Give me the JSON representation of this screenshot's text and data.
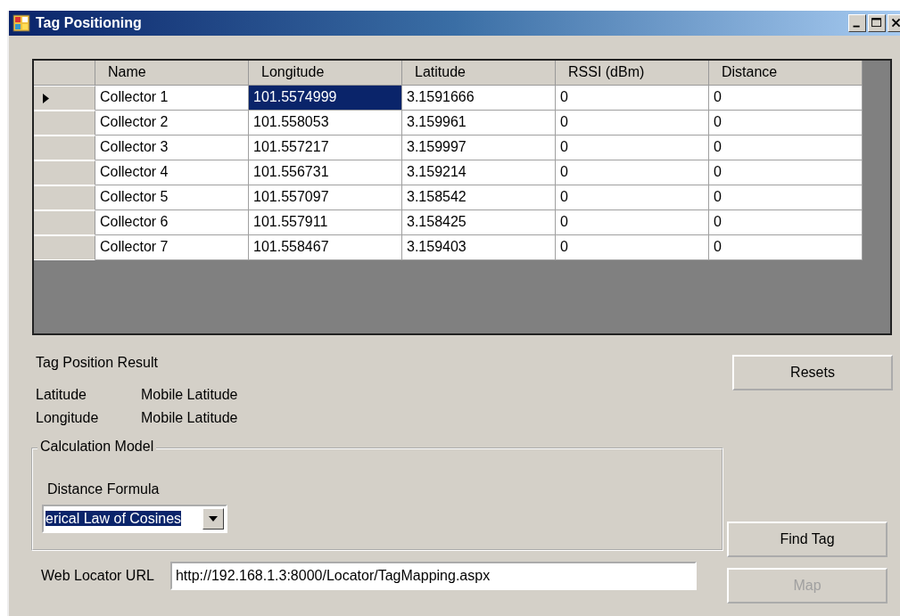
{
  "window": {
    "title": "Tag Positioning"
  },
  "table": {
    "columns": [
      "Name",
      "Longitude",
      "Latitude",
      "RSSI (dBm)",
      "Distance"
    ],
    "rows": [
      {
        "current": true,
        "cells": [
          {
            "text": "Collector 1",
            "selected": false
          },
          {
            "text": "101.5574999",
            "selected": true
          },
          {
            "text": "3.1591666",
            "selected": false
          },
          {
            "text": "0",
            "selected": false
          },
          {
            "text": "0",
            "selected": false
          }
        ]
      },
      {
        "current": false,
        "cells": [
          {
            "text": "Collector 2",
            "selected": false
          },
          {
            "text": "101.558053",
            "selected": false
          },
          {
            "text": "3.159961",
            "selected": false
          },
          {
            "text": "0",
            "selected": false
          },
          {
            "text": "0",
            "selected": false
          }
        ]
      },
      {
        "current": false,
        "cells": [
          {
            "text": "Collector 3",
            "selected": false
          },
          {
            "text": "101.557217",
            "selected": false
          },
          {
            "text": "3.159997",
            "selected": false
          },
          {
            "text": "0",
            "selected": false
          },
          {
            "text": "0",
            "selected": false
          }
        ]
      },
      {
        "current": false,
        "cells": [
          {
            "text": "Collector 4",
            "selected": false
          },
          {
            "text": "101.556731",
            "selected": false
          },
          {
            "text": "3.159214",
            "selected": false
          },
          {
            "text": "0",
            "selected": false
          },
          {
            "text": "0",
            "selected": false
          }
        ]
      },
      {
        "current": false,
        "cells": [
          {
            "text": "Collector 5",
            "selected": false
          },
          {
            "text": "101.557097",
            "selected": false
          },
          {
            "text": "3.158542",
            "selected": false
          },
          {
            "text": "0",
            "selected": false
          },
          {
            "text": "0",
            "selected": false
          }
        ]
      },
      {
        "current": false,
        "cells": [
          {
            "text": "Collector 6",
            "selected": false
          },
          {
            "text": "101.557911",
            "selected": false
          },
          {
            "text": "3.158425",
            "selected": false
          },
          {
            "text": "0",
            "selected": false
          },
          {
            "text": "0",
            "selected": false
          }
        ]
      },
      {
        "current": false,
        "cells": [
          {
            "text": "Collector 7",
            "selected": false
          },
          {
            "text": "101.558467",
            "selected": false
          },
          {
            "text": "3.159403",
            "selected": false
          },
          {
            "text": "0",
            "selected": false
          },
          {
            "text": "0",
            "selected": false
          }
        ]
      }
    ]
  },
  "result": {
    "title": "Tag Position Result",
    "fields": [
      {
        "label": "Latitude",
        "value": "Mobile Latitude"
      },
      {
        "label": "Longitude",
        "value": "Mobile Latitude"
      }
    ]
  },
  "calculation_model": {
    "title": "Calculation Model",
    "label": "Distance Formula",
    "combo": {
      "value": "erical Law of Cosines",
      "highlighted": true
    }
  },
  "web_locator": {
    "label": "Web Locator URL",
    "value": "http://192.168.1.3:8000/Locator/TagMapping.aspx"
  },
  "buttons": [
    {
      "label": "Resets",
      "disabled": false
    },
    {
      "label": "Find Tag",
      "disabled": false
    },
    {
      "label": "Map",
      "disabled": true
    }
  ]
}
